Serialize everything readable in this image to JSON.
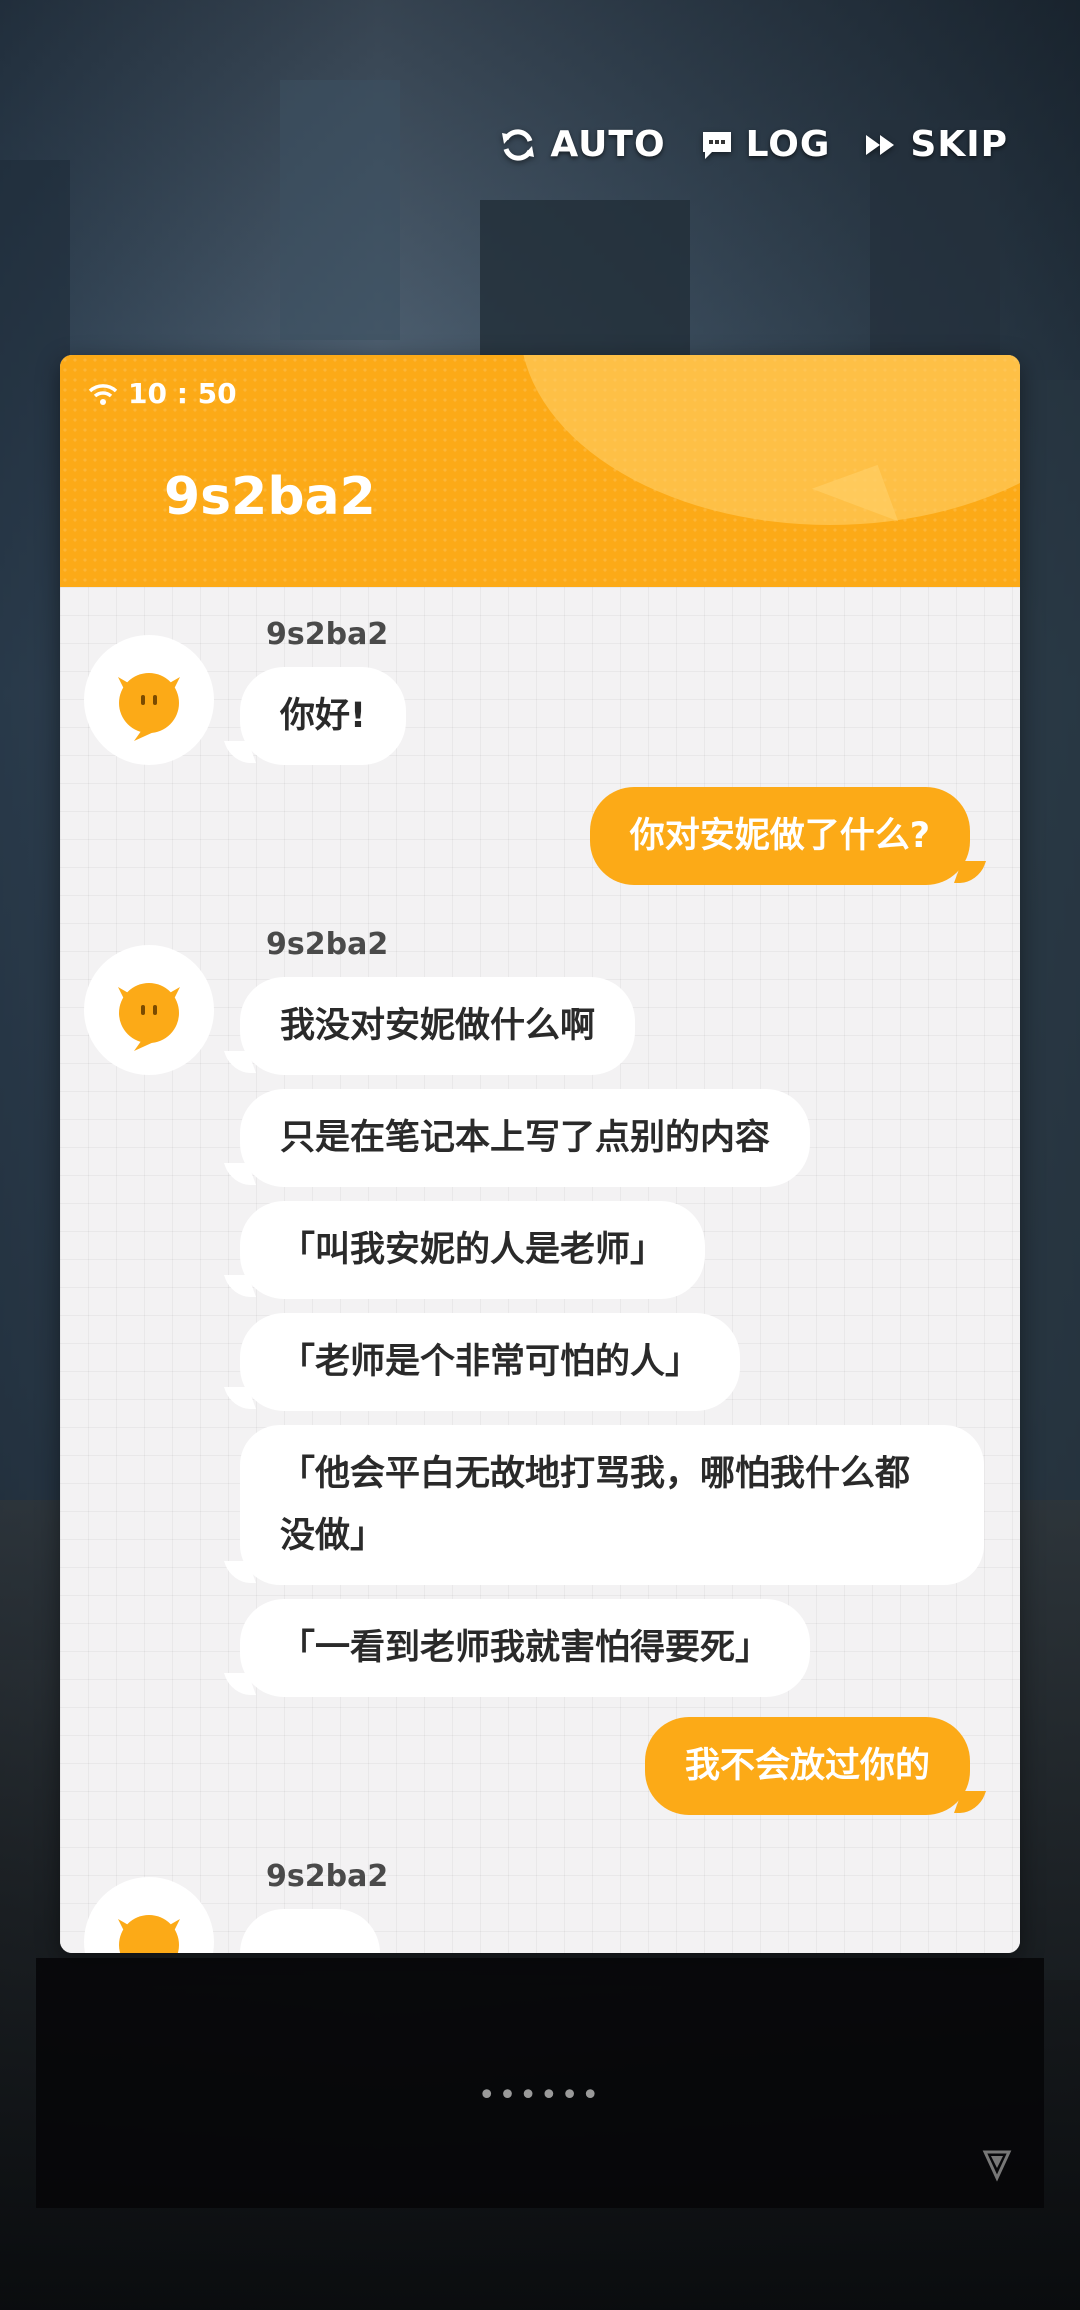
{
  "controls": {
    "auto_label": "AUTO",
    "log_label": "LOG",
    "skip_label": "SKIP"
  },
  "phone": {
    "time": "10 : 50",
    "title": "9s2ba2"
  },
  "messages": [
    {
      "side": "in",
      "sender": "9s2ba2",
      "text": "你好!"
    },
    {
      "side": "out",
      "text": "你对安妮做了什么?"
    },
    {
      "side": "in",
      "sender": "9s2ba2",
      "text": "我没对安妮做什么啊"
    },
    {
      "side": "in",
      "text": "只是在笔记本上写了点别的内容"
    },
    {
      "side": "in",
      "text": "「叫我安妮的人是老师」"
    },
    {
      "side": "in",
      "text": "「老师是个非常可怕的人」"
    },
    {
      "side": "in",
      "text_line1": "「他会平白无故地打骂我，哪怕我什么都",
      "text_line2": "没做」"
    },
    {
      "side": "in",
      "text": "「一看到老师我就害怕得要死」"
    },
    {
      "side": "out",
      "text": "我不会放过你的"
    },
    {
      "side": "in",
      "sender": "9s2ba2",
      "text": ""
    }
  ],
  "dialog": {
    "dots": "••••••"
  },
  "colors": {
    "accent": "#fcaa17",
    "chat_bg": "#f3f2f3",
    "bubble_in": "#ffffff"
  },
  "icons": {
    "auto": "refresh-icon",
    "log": "chat-bubble-icon",
    "skip": "fast-forward-icon",
    "wifi": "wifi-icon",
    "next": "chevron-down-icon"
  }
}
